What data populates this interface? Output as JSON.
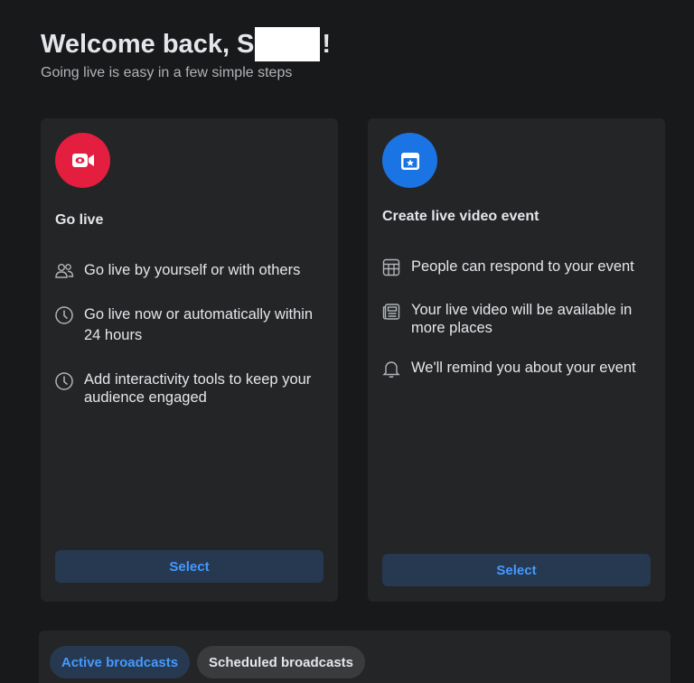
{
  "header": {
    "welcome_prefix": "Welcome back, S",
    "welcome_suffix": "!",
    "subtitle": "Going live is easy in a few simple steps"
  },
  "cards": [
    {
      "icon": "video-camera-icon",
      "accent": "#e41e3f",
      "title": "Go live",
      "features": [
        {
          "icon": "people-icon",
          "text": "Go live by yourself or with others"
        },
        {
          "icon": "clock-icon",
          "text": "Go live now or automatically within 24 hours"
        },
        {
          "icon": "clock-icon",
          "text": "Add interactivity tools to keep your audience engaged"
        }
      ],
      "button_label": "Select"
    },
    {
      "icon": "calendar-star-icon",
      "accent": "#1b74e4",
      "title": "Create live video event",
      "features": [
        {
          "icon": "grid-calendar-icon",
          "text": "People can respond to your event"
        },
        {
          "icon": "newsfeed-icon",
          "text": "Your live video will be available in more places"
        },
        {
          "icon": "bell-icon",
          "text": "We'll remind you about your event"
        }
      ],
      "button_label": "Select"
    }
  ],
  "tabs": [
    {
      "label": "Active broadcasts",
      "active": true
    },
    {
      "label": "Scheduled broadcasts",
      "active": false
    }
  ]
}
